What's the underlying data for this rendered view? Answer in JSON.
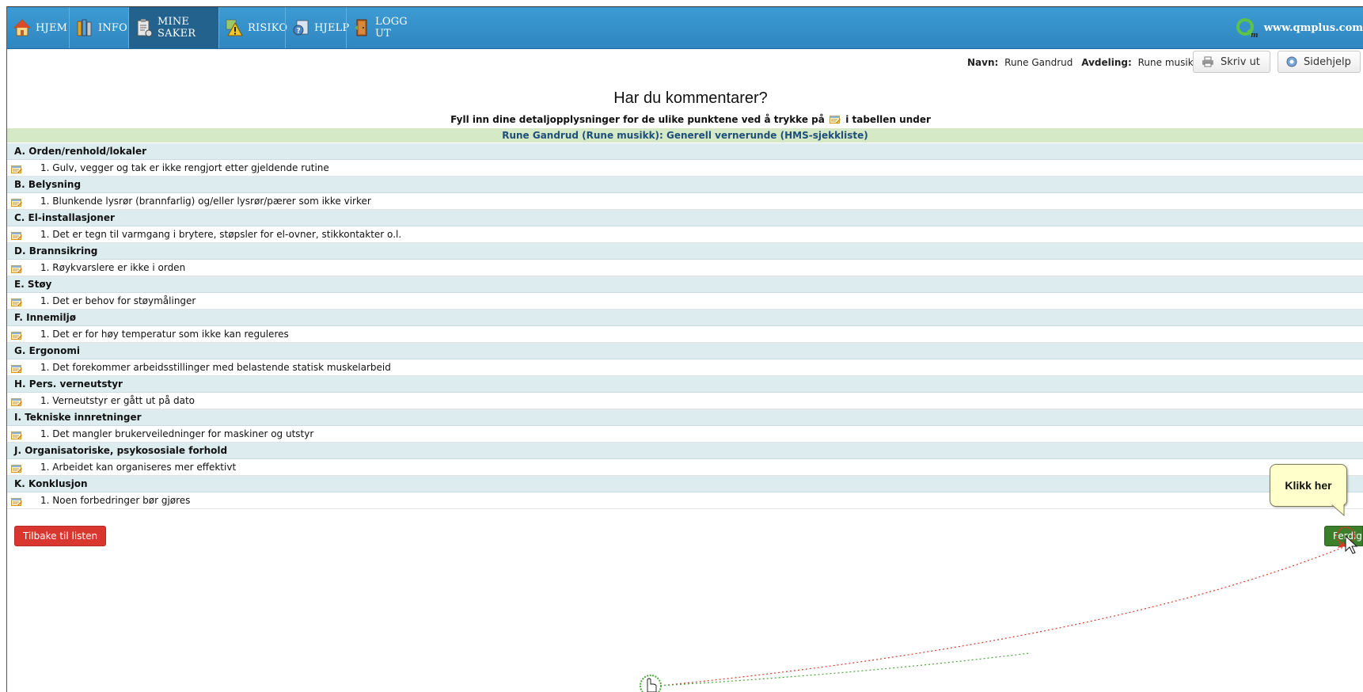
{
  "nav": {
    "items": [
      {
        "label": "HJEM",
        "icon": "home-icon"
      },
      {
        "label": "INFO",
        "icon": "books-icon"
      },
      {
        "label": "MINE SAKER",
        "icon": "clipboard-icon",
        "active": true
      },
      {
        "label": "RISIKO",
        "icon": "warning-icon"
      },
      {
        "label": "HJELP",
        "icon": "help-icon"
      },
      {
        "label": "LOGG UT",
        "icon": "door-icon"
      }
    ],
    "brand": "www.qmplus.com"
  },
  "user": {
    "name_label": "Navn:",
    "name_value": "Rune Gandrud",
    "dept_label": "Avdeling:",
    "dept_value": "Rune musikk"
  },
  "toolbar": {
    "print_label": "Skriv ut",
    "help_label": "Sidehjelp"
  },
  "page": {
    "title": "Har du kommentarer?",
    "subtitle_before": "Fyll inn dine detaljopplysninger for de ulike punktene ved å trykke på",
    "subtitle_after": "i tabellen under",
    "checklist_title": "Rune Gandrud (Rune musikk): Generell vernerunde (HMS-sjekkliste)"
  },
  "sections": [
    {
      "title": "A. Orden/renhold/lokaler",
      "item": "1. Gulv, vegger og tak er ikke rengjort etter gjeldende rutine"
    },
    {
      "title": "B. Belysning",
      "item": "1.  Blunkende lysrør (brannfarlig) og/eller lysrør/pærer som ikke virker"
    },
    {
      "title": "C. El-installasjoner",
      "item": "1. Det er tegn til varmgang i brytere, støpsler for el-ovner, stikkontakter o.l."
    },
    {
      "title": "D. Brannsikring",
      "item": "1. Røykvarslere er ikke i orden"
    },
    {
      "title": "E. Støy",
      "item": "1. Det er behov for støymålinger"
    },
    {
      "title": "F. Innemiljø",
      "item": "1. Det er for høy temperatur som ikke kan reguleres"
    },
    {
      "title": "G. Ergonomi",
      "item": "1. Det forekommer arbeidsstillinger med belastende statisk muskelarbeid"
    },
    {
      "title": "H. Pers. verneutstyr",
      "item": "1. Verneutstyr er gått ut på dato"
    },
    {
      "title": "I. Tekniske innretninger",
      "item": "1. Det mangler brukerveiledninger for maskiner og utstyr"
    },
    {
      "title": "J. Organisatoriske, psykososiale forhold",
      "item": "1. Arbeidet kan organiseres mer effektivt"
    },
    {
      "title": "K. Konklusjon",
      "item": "1. Noen forbedringer bør gjøres"
    }
  ],
  "actions": {
    "back_label": "Tilbake til listen",
    "done_label": "Ferdig"
  },
  "callout": {
    "text": "Klikk her"
  },
  "colors": {
    "nav": "#3d9bd3",
    "nav_active": "#24628e",
    "section_bg": "#dcecef",
    "green_bar": "#d6e9c6",
    "back_button": "#d9362f",
    "done_button": "#3b7f2b",
    "callout_bg": "#ffffcc"
  }
}
